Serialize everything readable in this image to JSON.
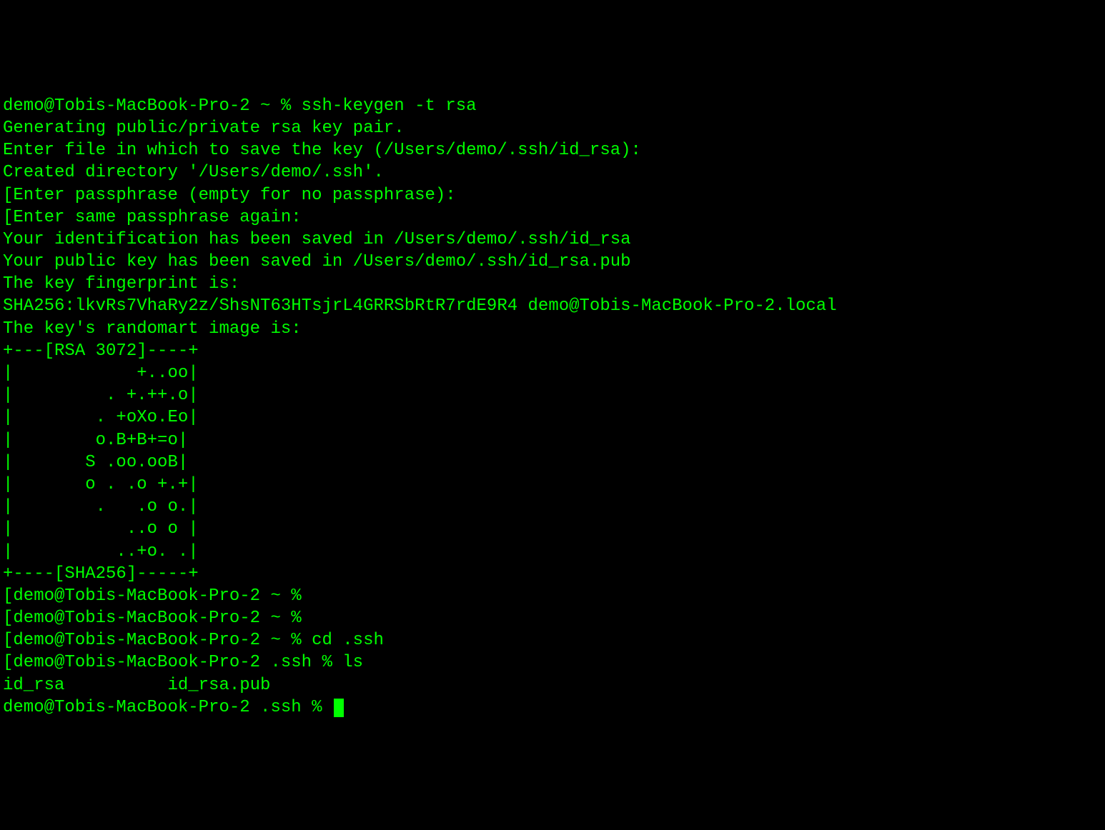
{
  "terminal": {
    "lines": [
      "demo@Tobis-MacBook-Pro-2 ~ % ssh-keygen -t rsa",
      "Generating public/private rsa key pair.",
      "Enter file in which to save the key (/Users/demo/.ssh/id_rsa):",
      "Created directory '/Users/demo/.ssh'.",
      "[Enter passphrase (empty for no passphrase):",
      "[Enter same passphrase again:",
      "Your identification has been saved in /Users/demo/.ssh/id_rsa",
      "Your public key has been saved in /Users/demo/.ssh/id_rsa.pub",
      "The key fingerprint is:",
      "SHA256:lkvRs7VhaRy2z/ShsNT63HTsjrL4GRRSbRtR7rdE9R4 demo@Tobis-MacBook-Pro-2.local",
      "The key's randomart image is:",
      "+---[RSA 3072]----+",
      "|            +..oo|",
      "|         . +.++.o|",
      "|        . +oXo.Eo|",
      "|        o.B+B+=o|",
      "|       S .oo.ooB|",
      "|       o . .o +.+|",
      "|        .   .o o.|",
      "|           ..o o |",
      "|          ..+o. .|",
      "+----[SHA256]-----+",
      "[demo@Tobis-MacBook-Pro-2 ~ %",
      "[demo@Tobis-MacBook-Pro-2 ~ %",
      "[demo@Tobis-MacBook-Pro-2 ~ % cd .ssh",
      "[demo@Tobis-MacBook-Pro-2 .ssh % ls",
      "id_rsa          id_rsa.pub",
      "demo@Tobis-MacBook-Pro-2 .ssh % "
    ]
  }
}
